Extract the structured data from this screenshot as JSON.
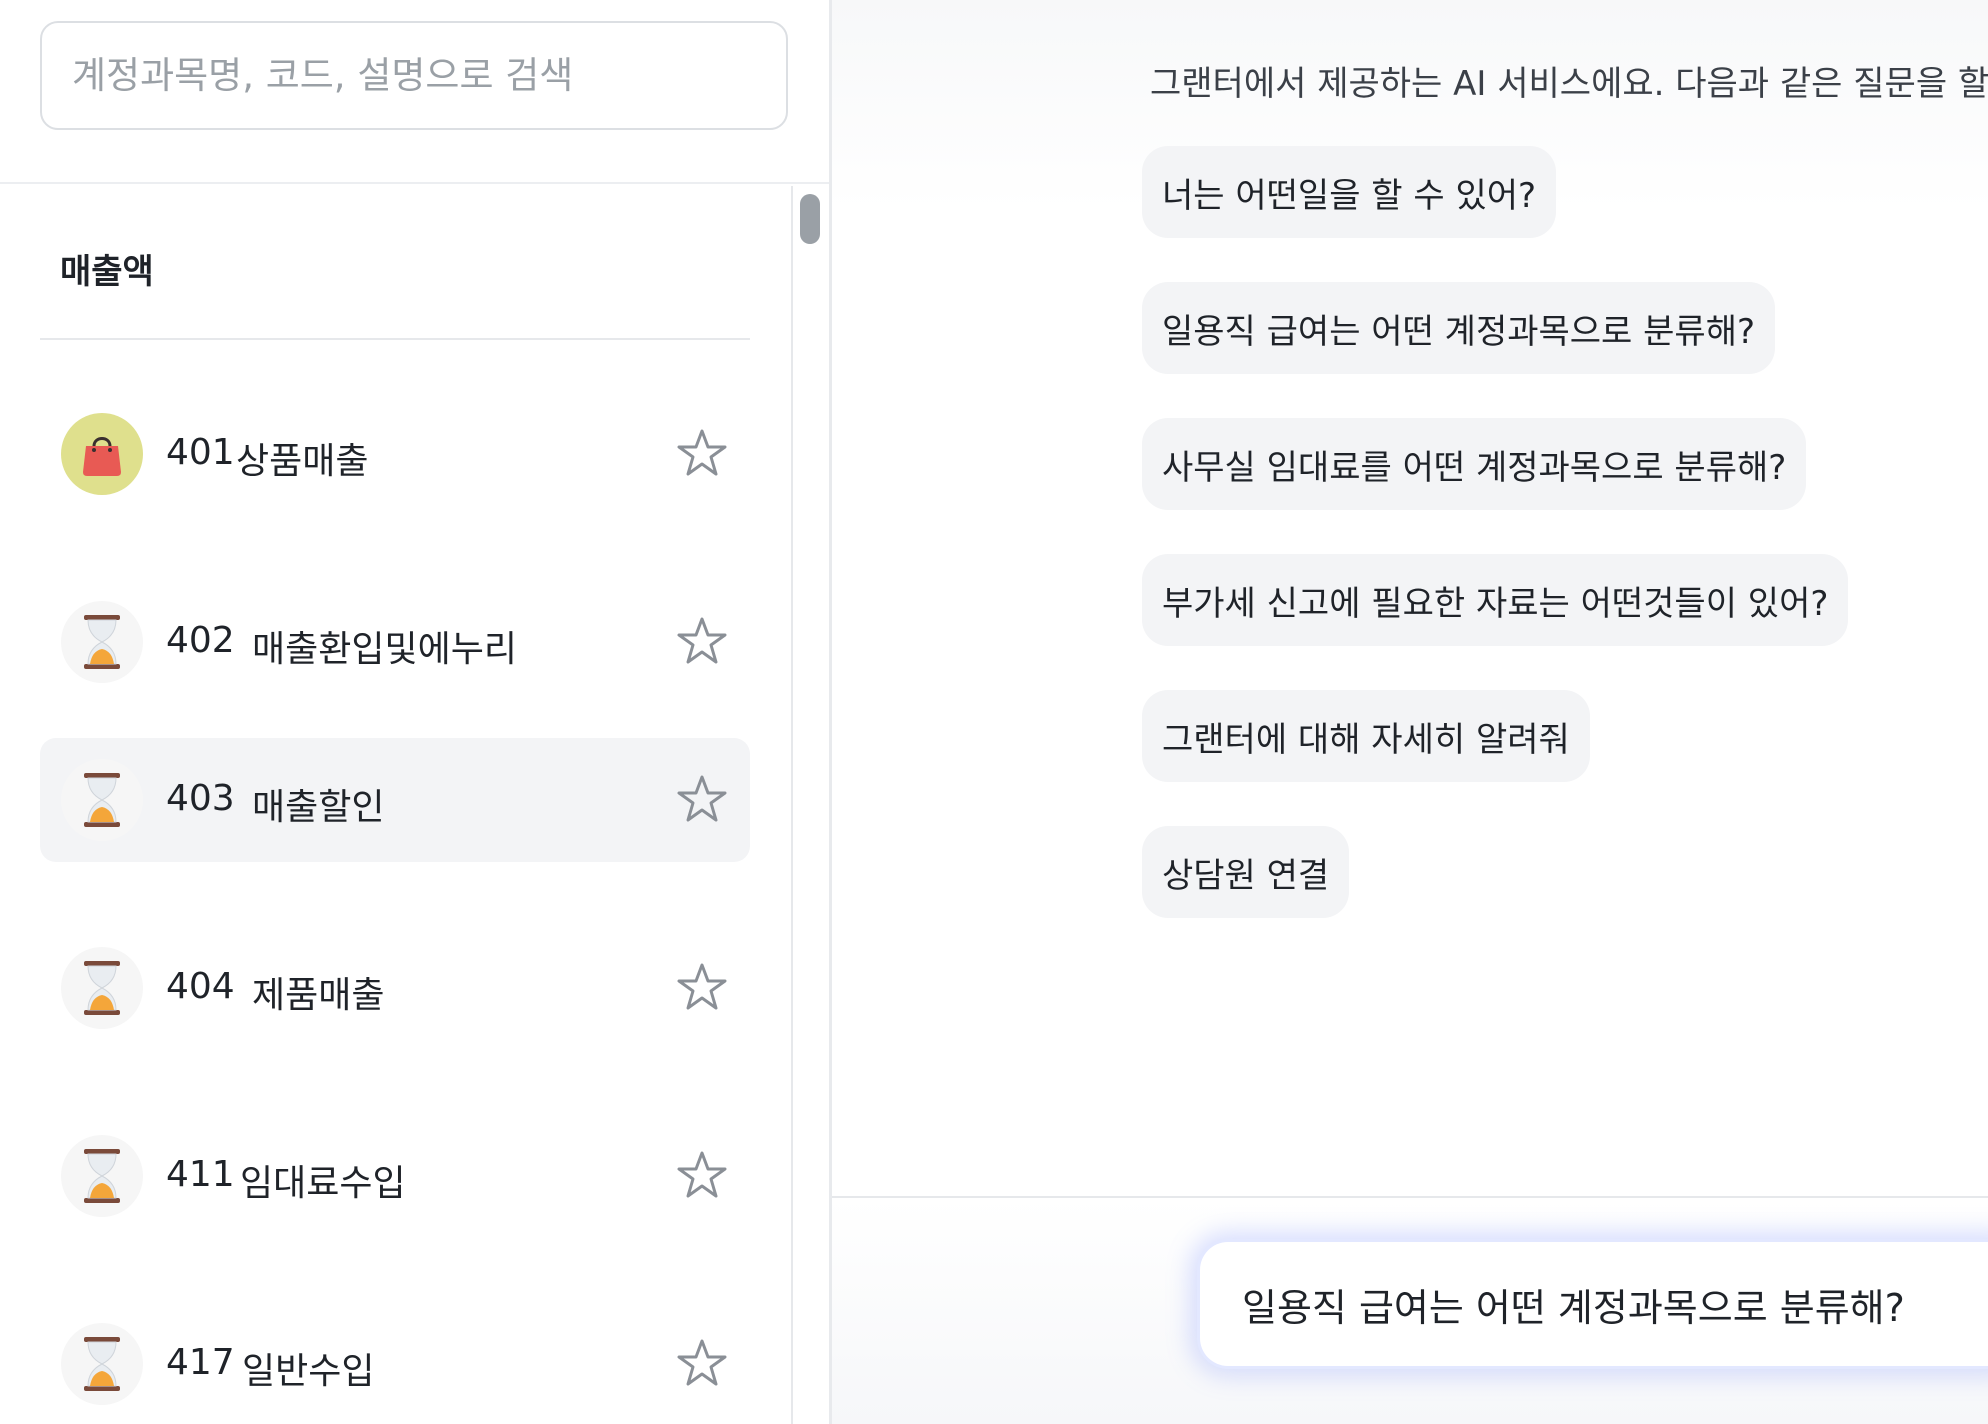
{
  "search": {
    "placeholder": "계정과목명, 코드, 설명으로 검색"
  },
  "section": {
    "title": "매출액"
  },
  "accounts": [
    {
      "code": "401",
      "name": "상품매출",
      "icon": "shopping-bag-icon",
      "selected": false
    },
    {
      "code": "402",
      "name": "매출환입및에누리",
      "icon": "hourglass-icon",
      "selected": false
    },
    {
      "code": "403",
      "name": "매출할인",
      "icon": "hourglass-icon",
      "selected": true
    },
    {
      "code": "404",
      "name": "제품매출",
      "icon": "hourglass-icon",
      "selected": false
    },
    {
      "code": "411",
      "name": "임대료수입",
      "icon": "hourglass-icon",
      "selected": false
    },
    {
      "code": "417",
      "name": "일반수입",
      "icon": "hourglass-icon",
      "selected": false
    }
  ],
  "chat": {
    "intro": "그랜터에서 제공하는 AI 서비스에요. 다음과 같은 질문을 할",
    "suggestions": [
      "너는 어떤일을 할 수 있어?",
      "일용직 급여는 어떤 계정과목으로 분류해?",
      "사무실 임대료를 어떤 계정과목으로 분류해?",
      "부가세 신고에 필요한 자료는 어떤것들이 있어?",
      "그랜터에 대해 자세히 알려줘",
      "상담원 연결"
    ],
    "input_value": "일용직 급여는 어떤 계정과목으로 분류해?"
  },
  "colors": {
    "selected_row": "#f3f4f6",
    "chip_bg": "#f3f4f6",
    "bag_bg": "#dfe08d",
    "bag": "#e85a54",
    "hourglass_sand": "#f4a63a",
    "star_outline": "#8a8f96"
  }
}
